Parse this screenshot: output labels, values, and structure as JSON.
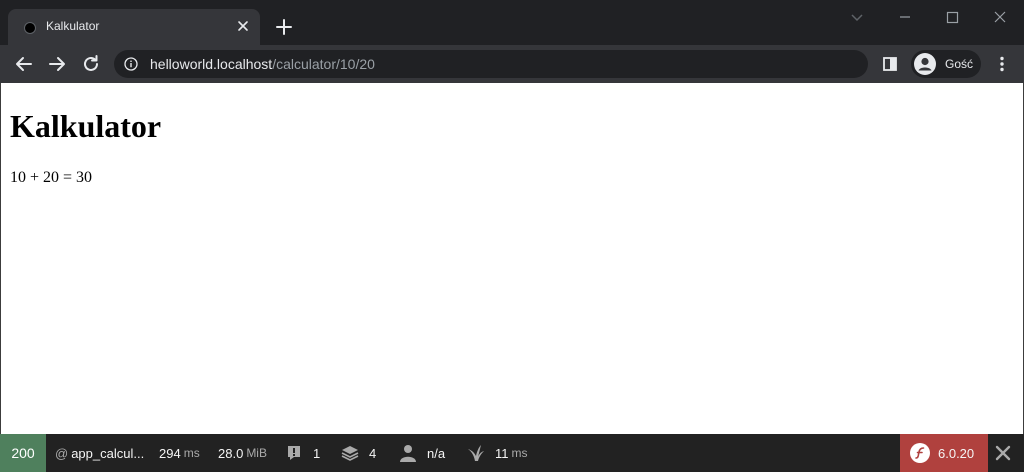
{
  "browser": {
    "tab": {
      "title": "Kalkulator"
    },
    "address": {
      "host": "helloworld.localhost",
      "path": "/calculator/10/20"
    },
    "profile": {
      "label": "Gość"
    }
  },
  "page": {
    "heading": "Kalkulator",
    "result": "10 + 20 = 30"
  },
  "debug_toolbar": {
    "status": "200",
    "route_prefix": "@",
    "route": "app_calcul...",
    "time": {
      "value": "294",
      "unit": "ms"
    },
    "memory": {
      "value": "28.0",
      "unit": "MiB"
    },
    "logs": "1",
    "cache_layers": "4",
    "user": "n/a",
    "twig": {
      "value": "11",
      "unit": "ms"
    },
    "version": "6.0.20"
  },
  "colors": {
    "tabstrip": "#202124",
    "toolbar": "#35363a",
    "status_ok": "#4f805d",
    "version_badge": "#b0413e",
    "debug_bar": "#222222"
  },
  "icons": {
    "favicon": "circle",
    "new_tab": "plus",
    "info": "info-circle",
    "logs": "exclamation-badge",
    "cache": "layers",
    "user": "person",
    "twig": "twig-leaf",
    "symfony": "sf-logo"
  }
}
